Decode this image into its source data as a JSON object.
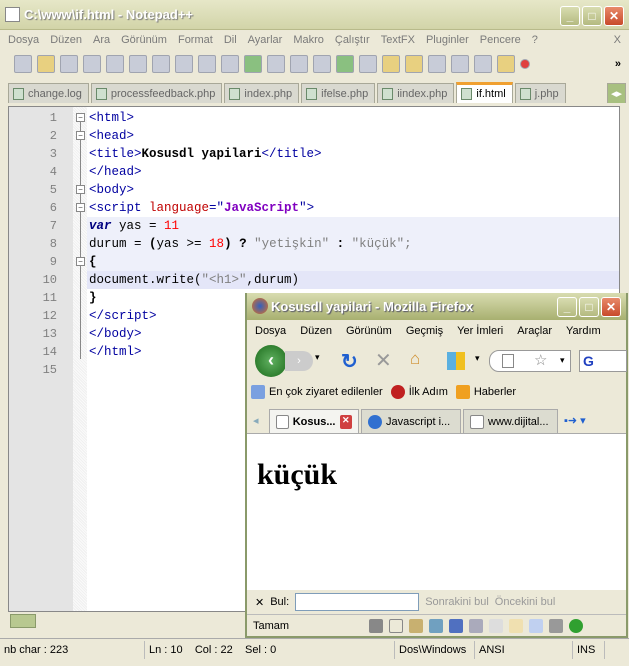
{
  "notepad": {
    "title": "C:\\www\\if.html - Notepad++",
    "menu": [
      "Dosya",
      "Düzen",
      "Ara",
      "Görünüm",
      "Format",
      "Dil",
      "Ayarlar",
      "Makro",
      "Çalıştır",
      "TextFX",
      "Pluginler",
      "Pencere",
      "?"
    ],
    "menu_close": "X",
    "toolbar_more": "»",
    "tabs": [
      {
        "label": "change.log"
      },
      {
        "label": "processfeedback.php"
      },
      {
        "label": "index.php"
      },
      {
        "label": "ifelse.php"
      },
      {
        "label": "iindex.php"
      },
      {
        "label": "if.html",
        "active": true
      },
      {
        "label": "j.php"
      }
    ],
    "line_numbers": [
      "1",
      "2",
      "3",
      "4",
      "5",
      "6",
      "7",
      "8",
      "9",
      "10",
      "11",
      "12",
      "13",
      "14",
      "15"
    ],
    "status": {
      "chars": "nb char : 223",
      "position": "Ln : 10    Col : 22    Sel : 0",
      "eol": "Dos\\Windows",
      "encoding": "ANSI",
      "mode": "INS"
    }
  },
  "code": {
    "l1": "<html>",
    "l2": "<head>",
    "l3a": "<title>",
    "l3b": "Kosusdl yapilari",
    "l3c": "</title>",
    "l4": "</head>",
    "l5": "<body>",
    "l6a": "<script ",
    "l6b": "language",
    "l6c": "=\"",
    "l6d": "JavaScript",
    "l6e": "\">",
    "l7a": "var",
    "l7b": " yas = ",
    "l7c": "11",
    "l8a": "durum = ",
    "l8b": "(",
    "l8c": "yas >= ",
    "l8d": "18",
    "l8e": ") ",
    "l8f": "?",
    "l8g": " \"yetişkin\" ",
    "l8h": ":",
    "l8i": " \"küçük\";",
    "l9": "{",
    "l10a": "document.write(",
    "l10b": "\"<h1>\"",
    "l10c": ",durum)",
    "l11": "}",
    "l12": "</script>",
    "l13": "</body>",
    "l14": "</html>"
  },
  "firefox": {
    "title": "Kosusdl yapilari - Mozilla Firefox",
    "menu": [
      "Dosya",
      "Düzen",
      "Görünüm",
      "Geçmiş",
      "Yer İmleri",
      "Araçlar",
      "Yardım"
    ],
    "bookmarks": [
      "En çok ziyaret edilenler",
      "İlk Adım",
      "Haberler"
    ],
    "tabs": [
      {
        "label": "Kosus...",
        "active": true
      },
      {
        "label": "Javascript i..."
      },
      {
        "label": "www.dijital..."
      }
    ],
    "content_heading": "küçük",
    "find": {
      "label": "Bul:",
      "value": "",
      "next": "Sonrakini bul",
      "prev": "Öncekini bul"
    },
    "status": "Tamam"
  }
}
